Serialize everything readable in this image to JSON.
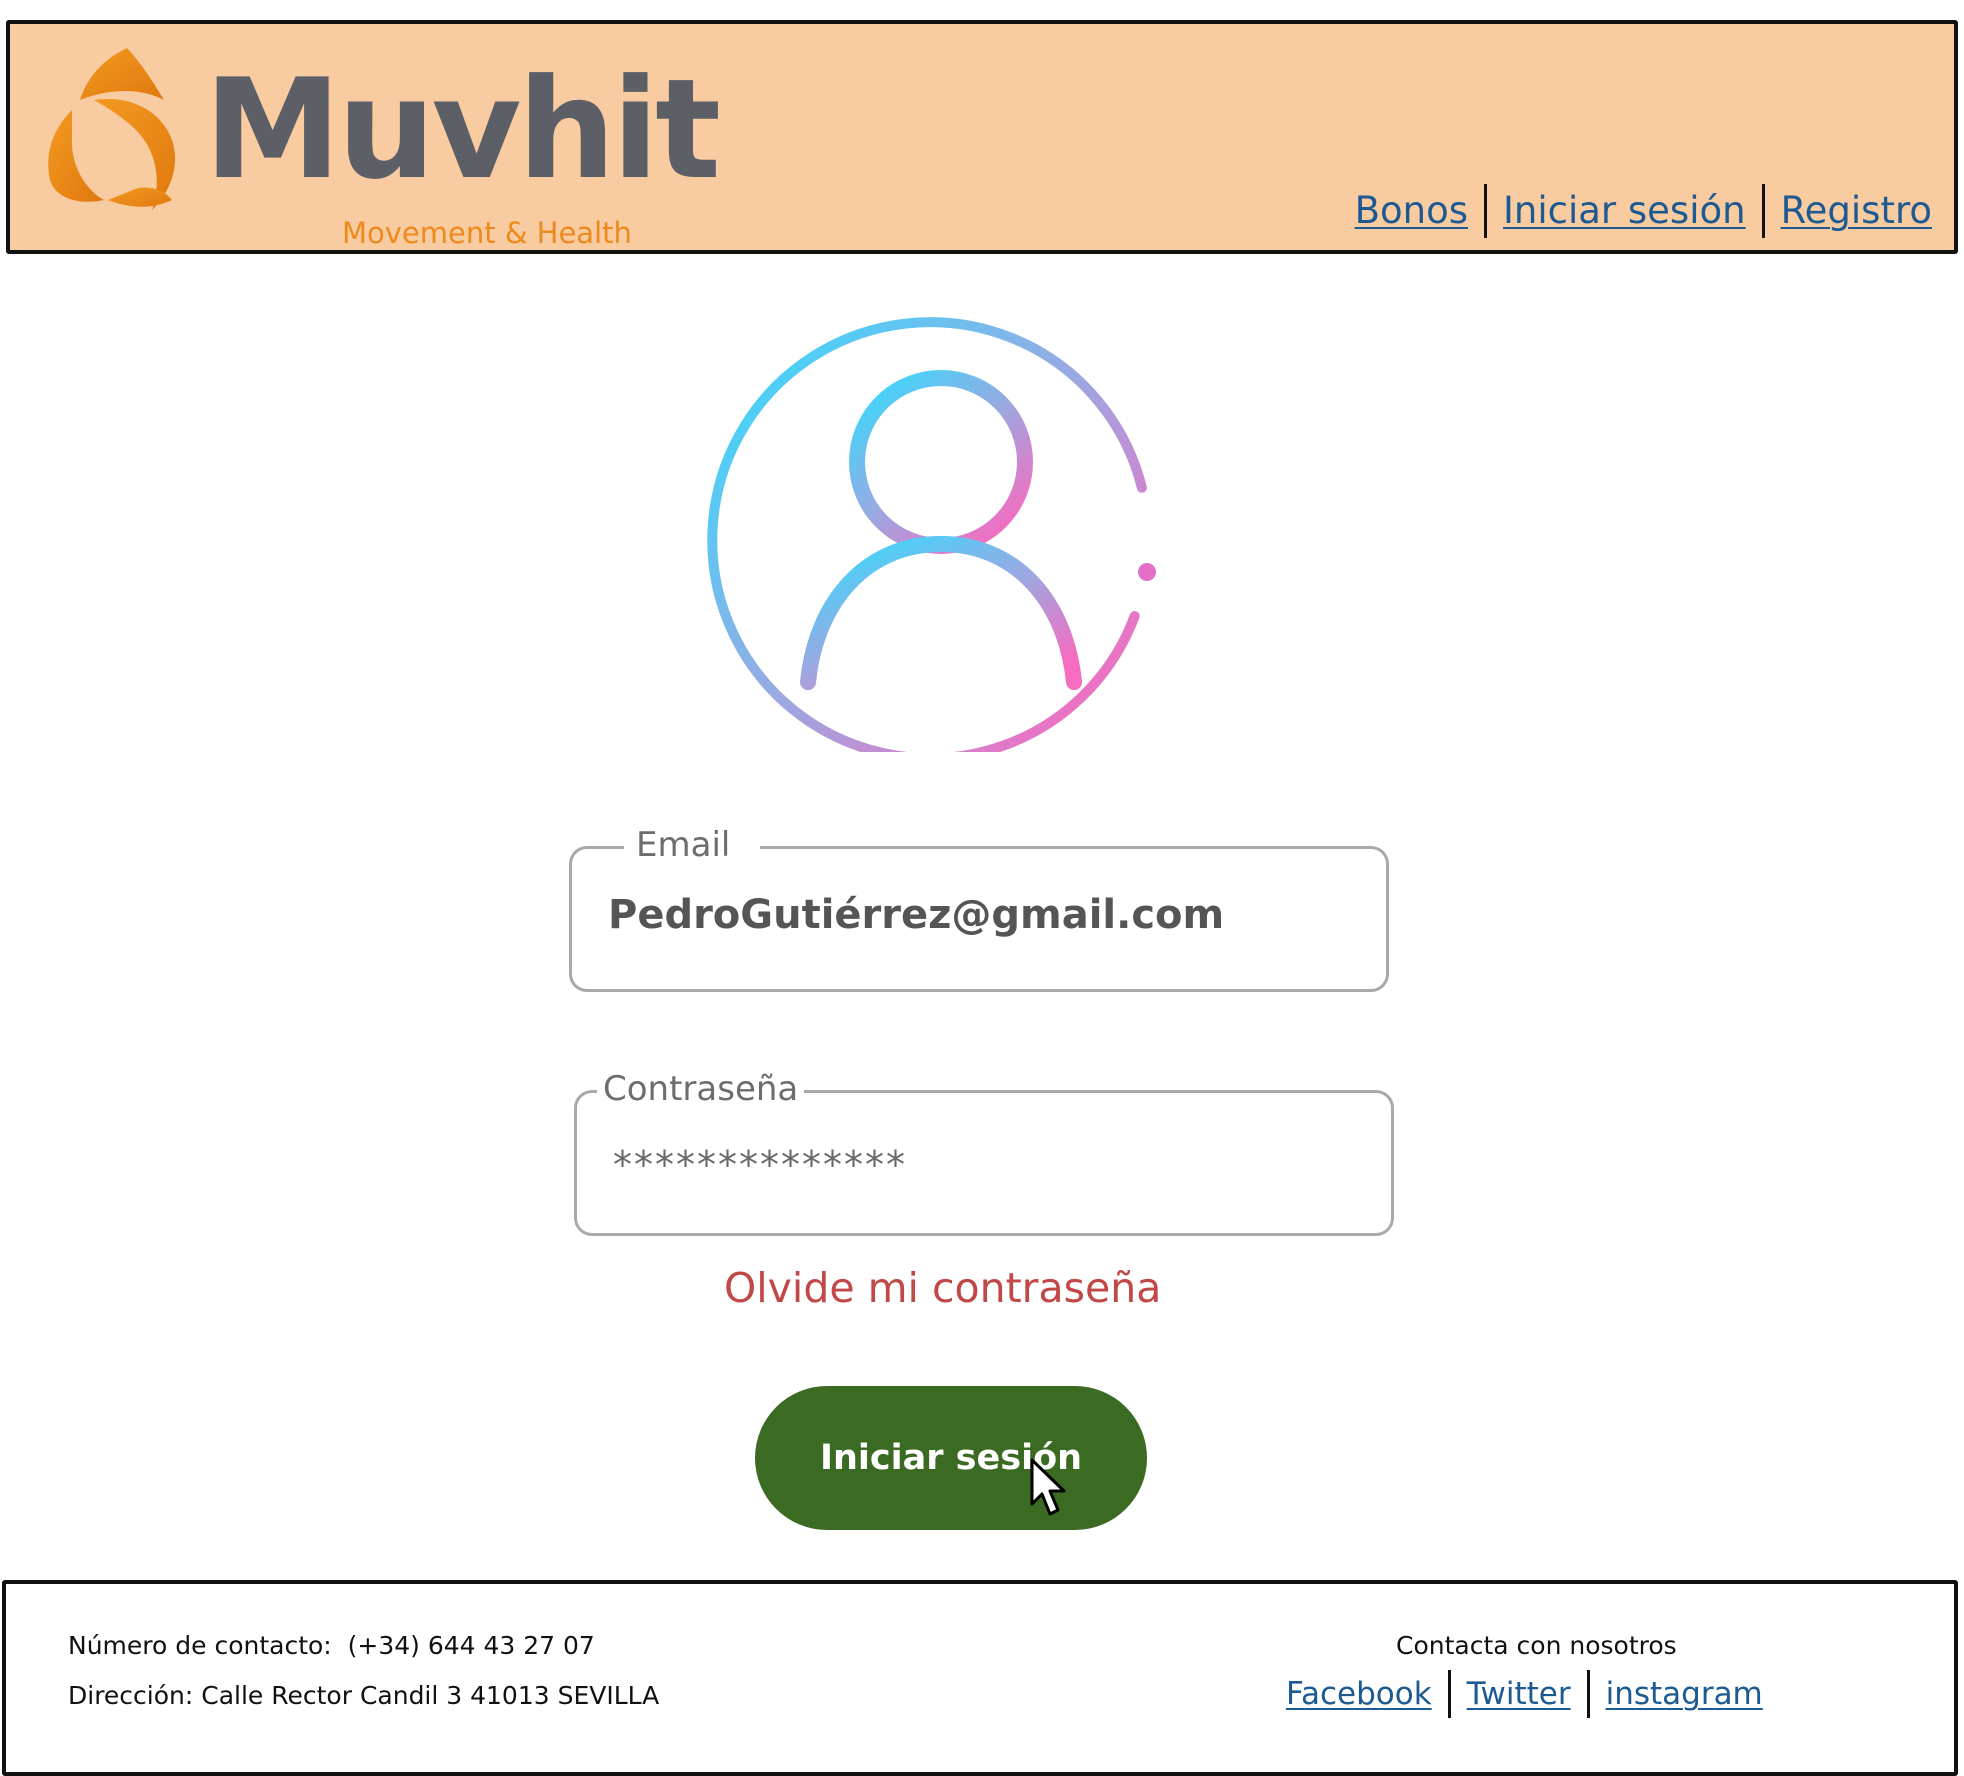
{
  "colors": {
    "header_bg": "#f8cba0",
    "brand_orange": "#ee8a1d",
    "brand_gray": "#5c5f66",
    "link_blue": "#1c5a91",
    "forgot_red": "#c24747",
    "button_green": "#3b6a22"
  },
  "header": {
    "logo": {
      "wordmark": "Muvhit",
      "tagline": "Movement & Health",
      "icon": "muvhit-swirl-logo-icon"
    },
    "nav": [
      {
        "label": "Bonos"
      },
      {
        "label": "Iniciar sesión"
      },
      {
        "label": "Registro"
      }
    ]
  },
  "avatar": {
    "icon": "user-avatar-icon"
  },
  "login_form": {
    "email": {
      "label": "Email",
      "value": "PedroGutiérrez@gmail.com"
    },
    "password": {
      "label": "Contraseña",
      "value": "**************"
    },
    "forgot_link": "Olvide mi contraseña",
    "submit_label": "Iniciar sesión"
  },
  "footer": {
    "phone_line": "Número de contacto:  (+34) 644 43 27 07",
    "address_line": "Dirección: Calle Rector Candil 3 41013 SEVILLA",
    "social_title": "Contacta con nosotros",
    "social_links": [
      {
        "label": "Facebook"
      },
      {
        "label": "Twitter"
      },
      {
        "label": "instagram"
      }
    ]
  }
}
